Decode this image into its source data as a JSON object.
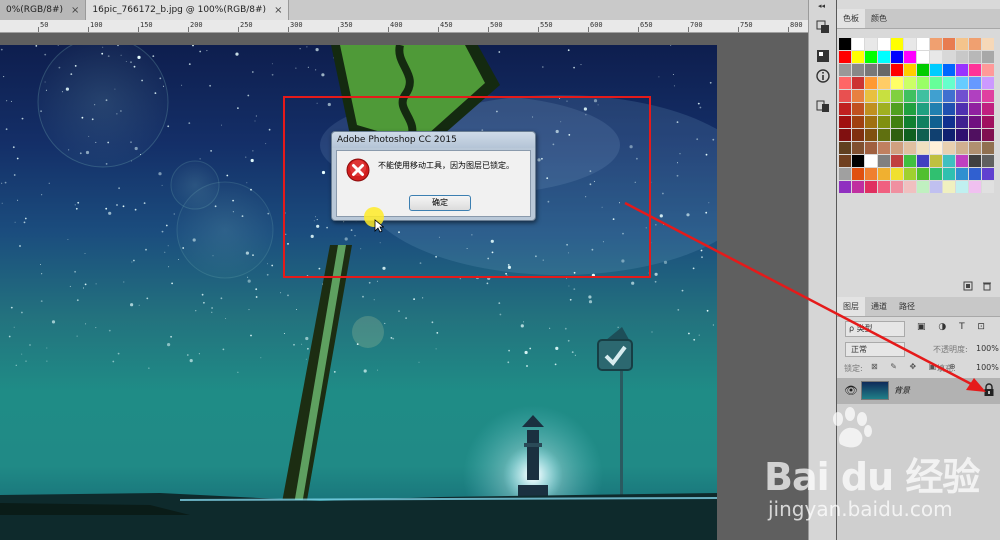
{
  "document_tabs": [
    {
      "label": "0%(RGB/8#)",
      "close": "×"
    },
    {
      "label": "16pic_766172_b.jpg @ 100%(RGB/8#)",
      "close": "×"
    }
  ],
  "ruler": {
    "ticks": [
      "50",
      "100",
      "150",
      "200",
      "250",
      "300",
      "350",
      "400",
      "450",
      "500",
      "550",
      "600",
      "650",
      "700",
      "750",
      "800",
      "850",
      "900",
      "950",
      "1000",
      "1050",
      "1100"
    ]
  },
  "dialog": {
    "title": "Adobe Photoshop CC 2015",
    "message": "不能使用移动工具，因为图层已锁定。",
    "ok_label": "确定"
  },
  "swatches_panel": {
    "tabs": [
      "色板",
      "颜色"
    ],
    "colors": [
      "#000000",
      "#ffffff",
      "#e8e8e8",
      "#ffffff",
      "#ffff00",
      "#e8e8e8",
      "#ffffff",
      "#f0a070",
      "#e87c50",
      "#f4c48c",
      "#f0a070",
      "#f6d8b8",
      "#ff0000",
      "#ffff00",
      "#00ff00",
      "#00ffff",
      "#0000ff",
      "#ff00ff",
      "#ffffff",
      "#e8e8e8",
      "#d8d8d8",
      "#c8c8c8",
      "#b8b8b8",
      "#a8a8a8",
      "#989898",
      "#888888",
      "#787878",
      "#686868",
      "#ff0000",
      "#ffcc00",
      "#00cc00",
      "#00ccff",
      "#0066ff",
      "#9933ff",
      "#ff3399",
      "#ff9999",
      "#ff6666",
      "#cc3333",
      "#ff9933",
      "#ffcc66",
      "#ffff66",
      "#ccff66",
      "#99ff66",
      "#66ff99",
      "#66ffcc",
      "#66ccff",
      "#6699ff",
      "#cc99ff",
      "#e85050",
      "#e88040",
      "#e8c040",
      "#c8e040",
      "#80d040",
      "#40c060",
      "#40c0a0",
      "#40a0d0",
      "#4070d0",
      "#7050d0",
      "#b040c0",
      "#e040a0",
      "#c02020",
      "#c05020",
      "#c09020",
      "#a0b020",
      "#50a020",
      "#20a040",
      "#20a080",
      "#2080b0",
      "#2050b0",
      "#5030b0",
      "#9020a0",
      "#c02080",
      "#a01010",
      "#a04010",
      "#a07010",
      "#809010",
      "#408010",
      "#108030",
      "#108060",
      "#106090",
      "#103090",
      "#402090",
      "#701080",
      "#a01060",
      "#801010",
      "#803010",
      "#805010",
      "#607010",
      "#306010",
      "#106020",
      "#106050",
      "#104070",
      "#102070",
      "#301070",
      "#501060",
      "#801050",
      "#604020",
      "#805030",
      "#a06040",
      "#c08060",
      "#d0a080",
      "#e0c0a0",
      "#f0e0c0",
      "#fff0d8",
      "#e8d0b0",
      "#d0b090",
      "#b09070",
      "#907050",
      "#704020",
      "#000000",
      "#ffffff",
      "#808080",
      "#c04040",
      "#40c040",
      "#4040c0",
      "#c0c040",
      "#40c0c0",
      "#c040c0",
      "#404040",
      "#606060",
      "#a0a0a0",
      "#e05010",
      "#f08030",
      "#f0b030",
      "#f0e030",
      "#a0d030",
      "#50c030",
      "#30c070",
      "#30c0b0",
      "#3090d0",
      "#3060d0",
      "#6040d0",
      "#9030c0",
      "#c030a0",
      "#e03060",
      "#f06080",
      "#f090a0",
      "#f0c0c0",
      "#c0f0c0",
      "#c0c0f0",
      "#f0f0c0",
      "#c0f0f0",
      "#f0c0f0",
      "#e0e0e0"
    ]
  },
  "layers_panel": {
    "tabs": [
      "图层",
      "通道",
      "路径"
    ],
    "kind_filter": "ρ 类型",
    "filter_icons": "▣ ◑ T ⊡",
    "blend_mode": "正常",
    "opacity_label": "不透明度:",
    "opacity_value": "100%",
    "lock_label": "锁定:",
    "lock_icons": "⊠ ✎ ✥ ▣ ⊕",
    "fill_label": "填充:",
    "fill_value": "100%",
    "layer_name": "背景"
  },
  "watermark": {
    "logo_text": "Bai du 经验",
    "url": "jingyan.baidu.com"
  },
  "colors": {
    "highlight": "#e51a1a",
    "cursor_highlight": "#ffeb28"
  }
}
